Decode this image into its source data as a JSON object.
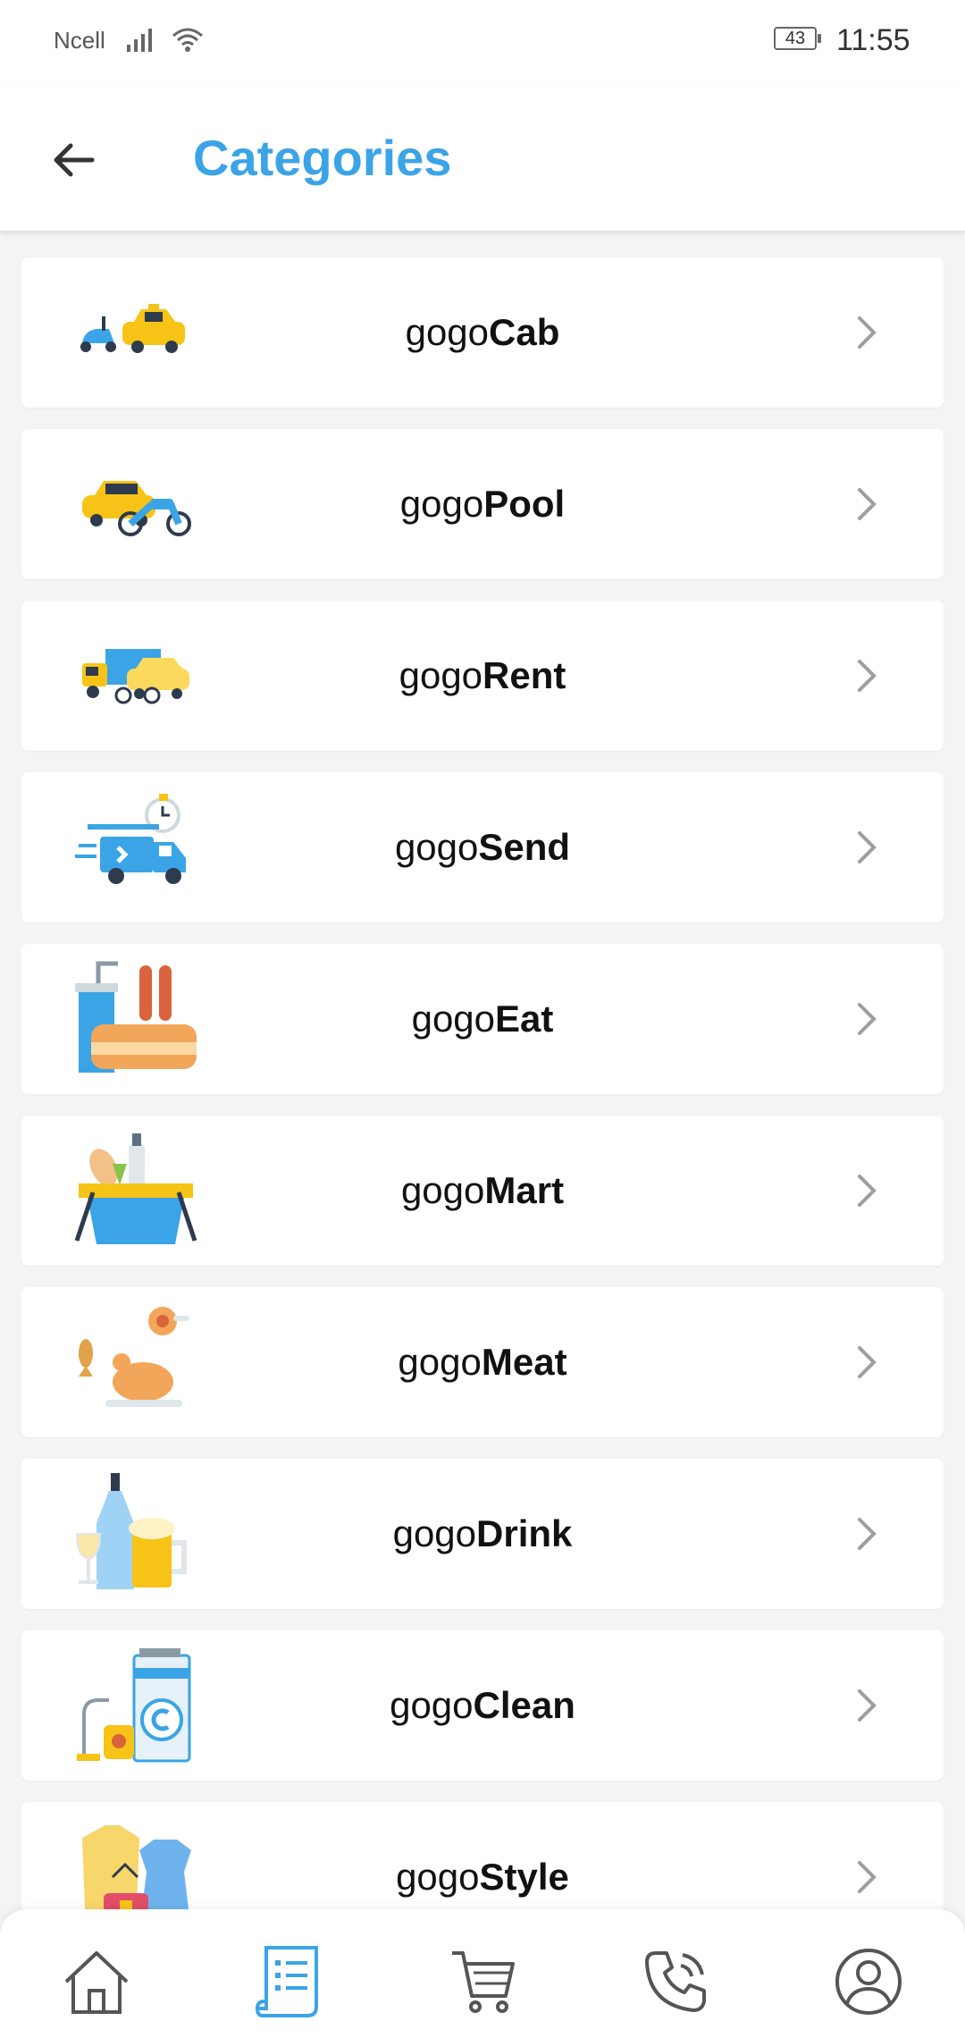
{
  "status_bar": {
    "carrier": "Ncell",
    "battery": "43",
    "time": "11:55"
  },
  "header": {
    "title": "Categories",
    "back_icon": "arrow-left-icon"
  },
  "categories": [
    {
      "prefix": "gogo",
      "name": "Cab",
      "icon": "scooter-taxi-icon"
    },
    {
      "prefix": "gogo",
      "name": "Pool",
      "icon": "taxi-motorbike-icon"
    },
    {
      "prefix": "gogo",
      "name": "Rent",
      "icon": "truck-car-bicycle-icon"
    },
    {
      "prefix": "gogo",
      "name": "Send",
      "icon": "delivery-van-timer-icon"
    },
    {
      "prefix": "gogo",
      "name": "Eat",
      "icon": "hotdog-drink-icon"
    },
    {
      "prefix": "gogo",
      "name": "Mart",
      "icon": "grocery-basket-icon"
    },
    {
      "prefix": "gogo",
      "name": "Meat",
      "icon": "roast-chicken-fish-icon"
    },
    {
      "prefix": "gogo",
      "name": "Drink",
      "icon": "wine-beer-icon"
    },
    {
      "prefix": "gogo",
      "name": "Clean",
      "icon": "washing-vacuum-icon"
    },
    {
      "prefix": "gogo",
      "name": "Style",
      "icon": "clothes-bag-icon"
    }
  ],
  "bottom_nav": [
    {
      "icon": "home-icon",
      "active": false
    },
    {
      "icon": "orders-list-icon",
      "active": true
    },
    {
      "icon": "cart-icon",
      "active": false
    },
    {
      "icon": "phone-call-icon",
      "active": false
    },
    {
      "icon": "profile-icon",
      "active": false
    }
  ],
  "colors": {
    "accent": "#3ba4e6",
    "chevron": "#9e9e9e",
    "nav_icon": "#555555"
  }
}
